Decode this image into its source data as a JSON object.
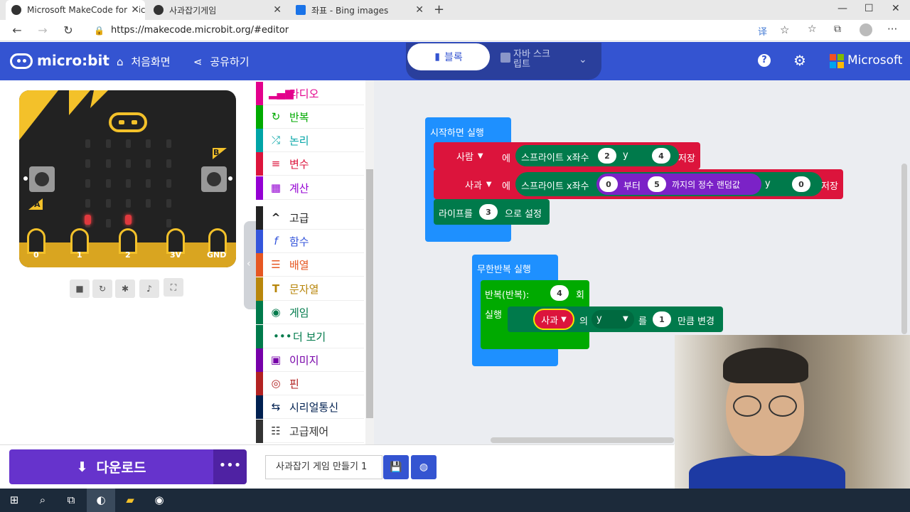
{
  "browser": {
    "tabs": [
      {
        "title": "Microsoft MakeCode for micro:bit"
      },
      {
        "title": "사과잡기게임"
      },
      {
        "title": "좌표 - Bing images"
      }
    ],
    "url": "https://makecode.microbit.org/#editor",
    "new_tab": "+"
  },
  "header": {
    "logo": "micro:bit",
    "home_label": "처음화면",
    "share_label": "공유하기",
    "blocks_label": "블록",
    "js_label": "자바 스크립트",
    "brand": "Microsoft",
    "accent_color": "#3454d1"
  },
  "simulator": {
    "buttons": [
      "A",
      "B"
    ],
    "pins": [
      "0",
      "1",
      "2",
      "3V",
      "GND"
    ],
    "controls": [
      "stop-icon",
      "restart-icon",
      "debug-icon",
      "sound-icon",
      "fullscreen-icon"
    ]
  },
  "toolbox": {
    "categories": [
      {
        "label": "라디오",
        "color": "#e3008c",
        "icon": "signal-icon"
      },
      {
        "label": "반복",
        "color": "#00aa00",
        "icon": "loop-icon"
      },
      {
        "label": "논리",
        "color": "#00a4a6",
        "icon": "shuffle-icon"
      },
      {
        "label": "변수",
        "color": "#dc143c",
        "icon": "list-icon"
      },
      {
        "label": "계산",
        "color": "#9400d3",
        "icon": "calculator-icon"
      },
      {
        "label": "고급",
        "color": "#222222",
        "icon": "chevron-up-icon"
      },
      {
        "label": "함수",
        "color": "#3455db",
        "icon": "function-icon"
      },
      {
        "label": "배열",
        "color": "#e65722",
        "icon": "array-icon"
      },
      {
        "label": "문자열",
        "color": "#b8860b",
        "icon": "text-icon"
      },
      {
        "label": "게임",
        "color": "#007a4b",
        "icon": "gamepad-icon"
      },
      {
        "label": "더 보기",
        "color": "#007a4b",
        "icon": "more-icon"
      },
      {
        "label": "이미지",
        "color": "#7600a8",
        "icon": "image-icon"
      },
      {
        "label": "핀",
        "color": "#b22222",
        "icon": "pin-icon"
      },
      {
        "label": "시리얼통신",
        "color": "#002050",
        "icon": "usb-icon"
      },
      {
        "label": "고급제어",
        "color": "#333333",
        "icon": "control-icon"
      }
    ]
  },
  "workspace": {
    "start_block": {
      "label": "시작하면 실행",
      "stmt1": {
        "var": "사람",
        "to": "에",
        "sprite": "스프라이트 x좌수",
        "x": "2",
        "y_label": "y",
        "y": "4",
        "save": "저장"
      },
      "stmt2": {
        "var": "사과",
        "to": "에",
        "sprite": "스프라이트 x좌수",
        "from": "0",
        "from_label": "부터",
        "to_val": "5",
        "rand_label": "까지의 정수 랜덤값",
        "y_label": "y",
        "y": "0",
        "save": "저장"
      },
      "stmt3": {
        "label": "라이프를",
        "value": "3",
        "suffix": "으로 설정"
      }
    },
    "forever_block": {
      "label": "무한반복 실행",
      "repeat_label": "반복(반복):",
      "repeat_count": "4",
      "repeat_suffix": "회",
      "do_label": "실행",
      "change": {
        "var": "사과",
        "of": "의",
        "prop": "y",
        "particle": "를",
        "value": "1",
        "suffix": "만큼 변경"
      }
    }
  },
  "bottom": {
    "download_label": "다운로드",
    "more_label": "•••",
    "project_name": "사과잡기 게임 만들기 1"
  }
}
